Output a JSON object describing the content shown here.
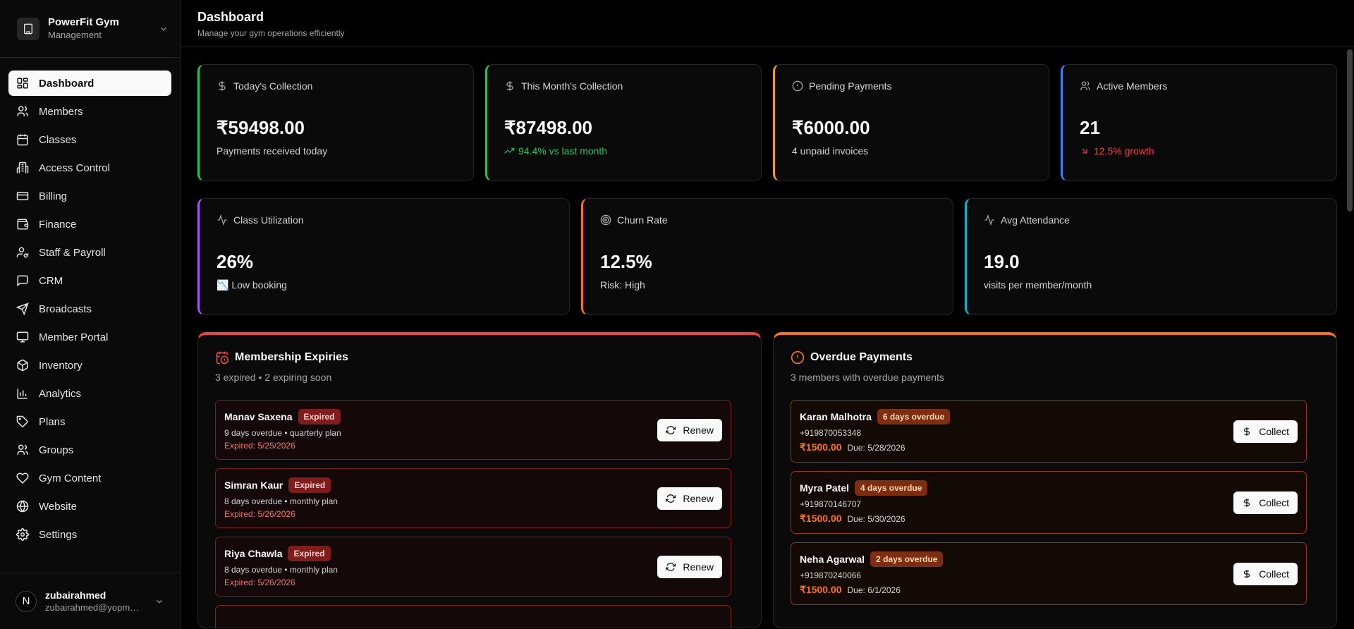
{
  "brand": {
    "name": "PowerFit Gym",
    "sub": "Management"
  },
  "nav": [
    {
      "label": "Dashboard",
      "icon": "dashboard-icon"
    },
    {
      "label": "Members",
      "icon": "users-icon"
    },
    {
      "label": "Classes",
      "icon": "calendar-icon"
    },
    {
      "label": "Access Control",
      "icon": "building-icon"
    },
    {
      "label": "Billing",
      "icon": "credit-card-icon"
    },
    {
      "label": "Finance",
      "icon": "wallet-icon"
    },
    {
      "label": "Staff & Payroll",
      "icon": "user-cog-icon"
    },
    {
      "label": "CRM",
      "icon": "message-icon"
    },
    {
      "label": "Broadcasts",
      "icon": "send-icon"
    },
    {
      "label": "Member Portal",
      "icon": "monitor-icon"
    },
    {
      "label": "Inventory",
      "icon": "package-icon"
    },
    {
      "label": "Analytics",
      "icon": "bar-chart-icon"
    },
    {
      "label": "Plans",
      "icon": "tag-icon"
    },
    {
      "label": "Groups",
      "icon": "users-icon"
    },
    {
      "label": "Gym Content",
      "icon": "heart-icon"
    },
    {
      "label": "Website",
      "icon": "globe-icon"
    },
    {
      "label": "Settings",
      "icon": "gear-icon"
    }
  ],
  "user": {
    "initial": "N",
    "name": "zubairahmed",
    "email": "zubairahmed@yopmail.com"
  },
  "header": {
    "title": "Dashboard",
    "subtitle": "Manage your gym operations efficiently"
  },
  "stats_top": [
    {
      "label": "Today's Collection",
      "value": "₹59498.00",
      "note": "Payments received today",
      "accent": "#22c55e",
      "icon": "dollar-icon"
    },
    {
      "label": "This Month's Collection",
      "value": "₹87498.00",
      "note": "94.4% vs last month",
      "accent": "#22c55e",
      "icon": "dollar-icon"
    },
    {
      "label": "Pending Payments",
      "value": "₹6000.00",
      "note": "4 unpaid invoices",
      "accent": "#f59e0b",
      "icon": "alert-circle-icon"
    },
    {
      "label": "Active Members",
      "value": "21",
      "note": "12.5% growth",
      "accent": "#3b82f6",
      "icon": "users-icon"
    }
  ],
  "stats_mid": [
    {
      "label": "Class Utilization",
      "value": "26%",
      "note": "📉 Low booking",
      "accent": "#a855f7",
      "icon": "activity-icon"
    },
    {
      "label": "Churn Rate",
      "value": "12.5%",
      "note": "Risk: High",
      "accent": "#f97316",
      "icon": "target-icon"
    },
    {
      "label": "Avg Attendance",
      "value": "19.0",
      "note": "visits per member/month",
      "accent": "#06b6d4",
      "icon": "activity-icon"
    }
  ],
  "expiries": {
    "title": "Membership Expiries",
    "subtitle": "3 expired • 2 expiring soon",
    "accent": "#ef4444",
    "items": [
      {
        "name": "Manav Saxena",
        "badge": "Expired",
        "detail": "9 days overdue • quarterly plan",
        "expired": "Expired: 5/25/2026",
        "action": "Renew"
      },
      {
        "name": "Simran Kaur",
        "badge": "Expired",
        "detail": "8 days overdue • monthly plan",
        "expired": "Expired: 5/26/2026",
        "action": "Renew"
      },
      {
        "name": "Riya Chawla",
        "badge": "Expired",
        "detail": "8 days overdue • monthly plan",
        "expired": "Expired: 5/26/2026",
        "action": "Renew"
      }
    ]
  },
  "overdue": {
    "title": "Overdue Payments",
    "subtitle": "3 members with overdue payments",
    "accent": "#f97316",
    "items": [
      {
        "name": "Karan Malhotra",
        "badge": "6 days overdue",
        "phone": "+919870053348",
        "amount": "₹1500.00",
        "due": "Due: 5/28/2026",
        "action": "Collect"
      },
      {
        "name": "Myra Patel",
        "badge": "4 days overdue",
        "phone": "+919870146707",
        "amount": "₹1500.00",
        "due": "Due: 5/30/2026",
        "action": "Collect"
      },
      {
        "name": "Neha Agarwal",
        "badge": "2 days overdue",
        "phone": "+919870240066",
        "amount": "₹1500.00",
        "due": "Due: 6/1/2026",
        "action": "Collect"
      }
    ]
  }
}
